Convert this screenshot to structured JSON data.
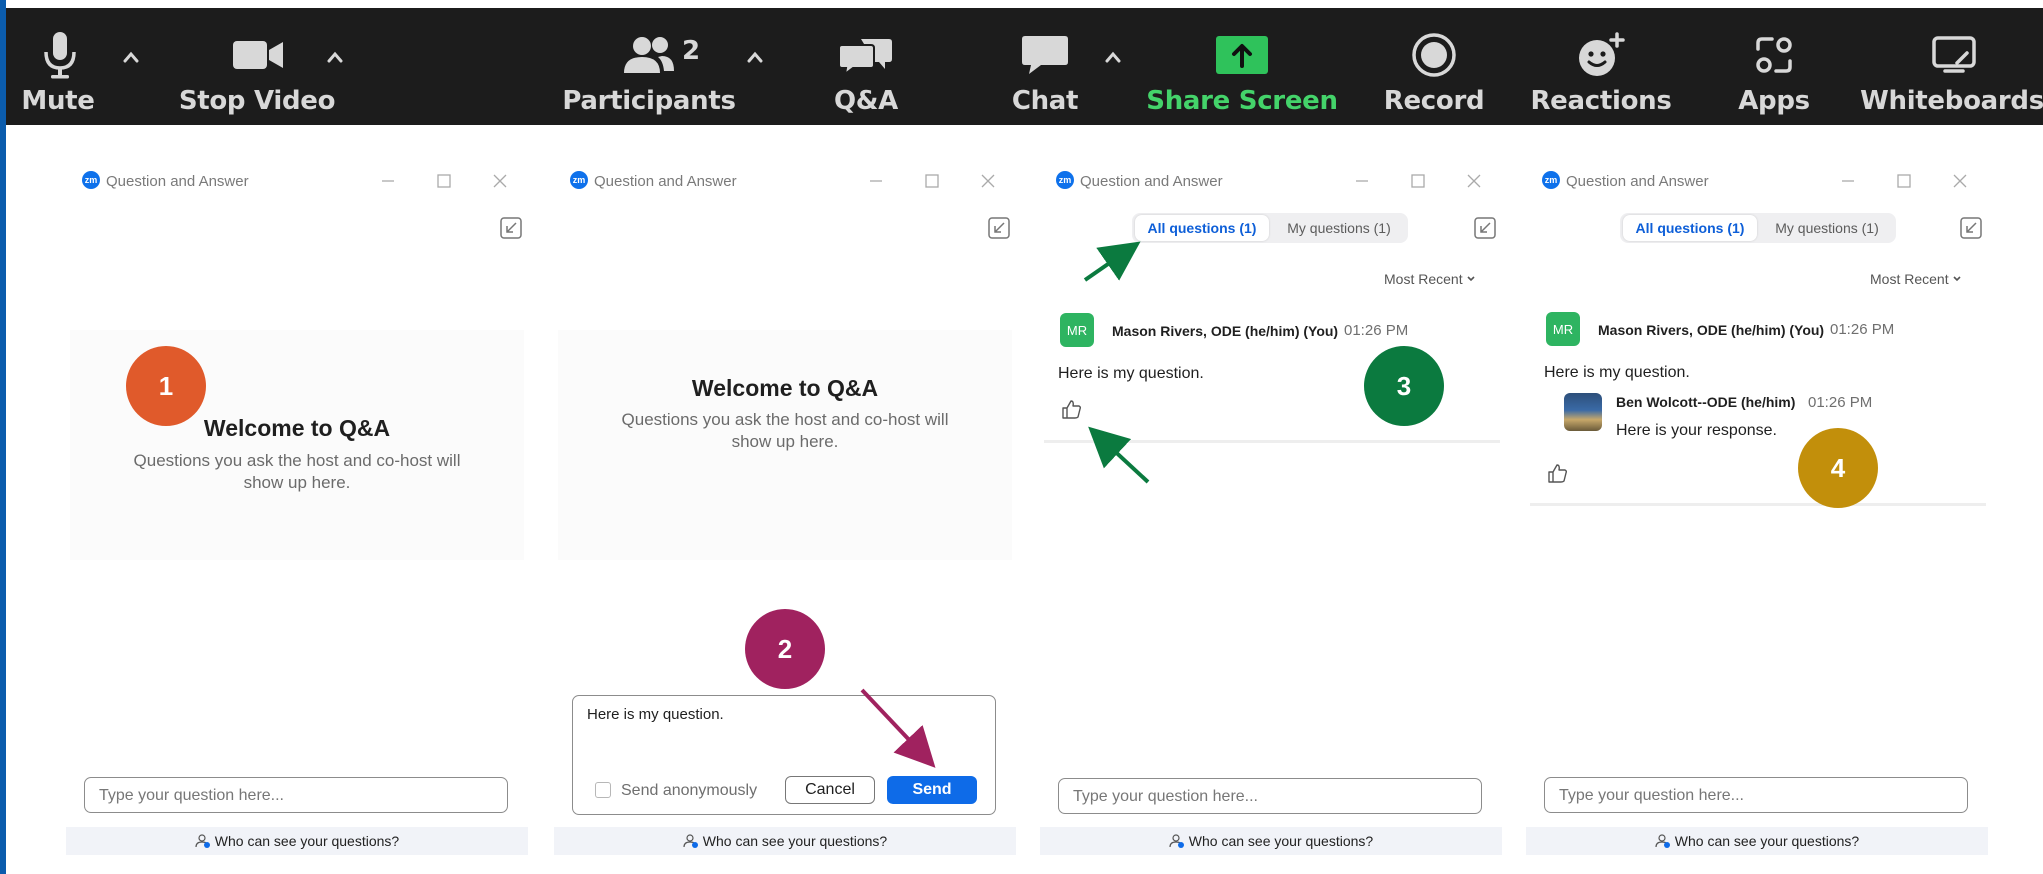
{
  "toolbar": {
    "mute": "Mute",
    "stop_video": "Stop Video",
    "participants": "Participants",
    "participants_count": "2",
    "qa": "Q&A",
    "chat": "Chat",
    "share_screen": "Share Screen",
    "record": "Record",
    "reactions": "Reactions",
    "apps": "Apps",
    "whiteboards": "Whiteboards"
  },
  "common": {
    "window_title": "Question and Answer",
    "zm_logo": "zm",
    "welcome_title": "Welcome to Q&A",
    "welcome_sub": "Questions you ask the host and co-host will show up here.",
    "input_placeholder": "Type your question here...",
    "footer": "Who can see your questions?",
    "tab_all": "All questions (1)",
    "tab_mine": "My questions (1)",
    "sort": "Most Recent"
  },
  "compose": {
    "text": "Here is my question.",
    "anonymous": "Send anonymously",
    "cancel": "Cancel",
    "send": "Send"
  },
  "question": {
    "initials": "MR",
    "name": "Mason Rivers, ODE (he/him) (You)",
    "time": "01:26 PM",
    "text": "Here is my question."
  },
  "response": {
    "name": "Ben Wolcott--ODE (he/him)",
    "time": "01:26 PM",
    "text": "Here is your response."
  },
  "badges": [
    "1",
    "2",
    "3",
    "4"
  ],
  "colors": {
    "badge1": "#e05a2b",
    "badge2": "#a0225f",
    "badge3": "#0b7a3f",
    "badge4": "#c28f0b",
    "share_green": "#44d36a",
    "accent_blue": "#0e6be8"
  }
}
